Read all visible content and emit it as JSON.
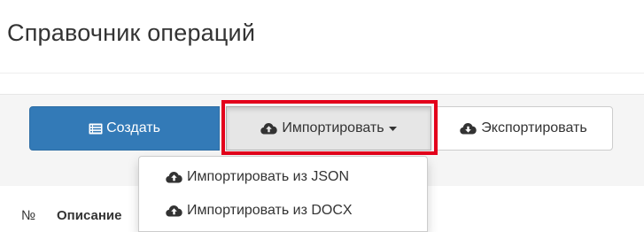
{
  "page": {
    "title": "Справочник операций"
  },
  "toolbar": {
    "create": {
      "label": "Создать",
      "icon": "list-alt-icon"
    },
    "import": {
      "label": "Импортировать",
      "icon": "cloud-upload-icon",
      "caret": "chevron-down-icon",
      "highlighted": true
    },
    "export": {
      "label": "Экспортировать",
      "icon": "cloud-download-icon"
    }
  },
  "import_menu": {
    "items": [
      {
        "label": "Импортировать из JSON",
        "icon": "cloud-upload-icon"
      },
      {
        "label": "Импортировать из DOCX",
        "icon": "cloud-upload-icon"
      }
    ]
  },
  "table": {
    "columns": [
      "№",
      "Описание"
    ]
  },
  "colors": {
    "primary": "#337ab7",
    "highlight": "#e3001b",
    "text": "#333333"
  }
}
